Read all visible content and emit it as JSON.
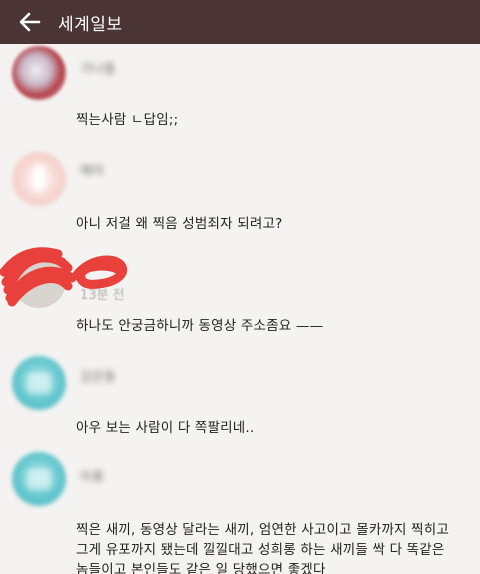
{
  "appbar": {
    "title": "세계일보",
    "back_icon": "arrow-left-icon"
  },
  "comments": [
    {
      "nickname": "가나돌",
      "time": "",
      "text": "찍는사람 ㄴ답임;;"
    },
    {
      "nickname": "해아",
      "time": "",
      "text": "아니 저걸 왜 찍음 성범죄자 되려고?"
    },
    {
      "nickname": "",
      "time": "13분 전",
      "text": "하나도 안궁금하니까 동영상 주소좀요 ——"
    },
    {
      "nickname": "김은동",
      "time": "",
      "text": "아우 보는 사람이 다 쪽팔리네.."
    },
    {
      "nickname": "아롱",
      "time": "",
      "text": "찍은 새끼, 동영상 달라는 새끼, 엄연한 사고이고 몰카까지 찍히고\n그게 유포까지 됐는데 낄낄대고 성희롱 하는 새끼들 싹 다 똑같은\n놈들이고 본인들도 같은 일 당했으면 좋겠다"
    }
  ],
  "colors": {
    "appbar_bg": "#4a3434",
    "background": "#f4f3f1",
    "redaction": "#e8403a"
  }
}
